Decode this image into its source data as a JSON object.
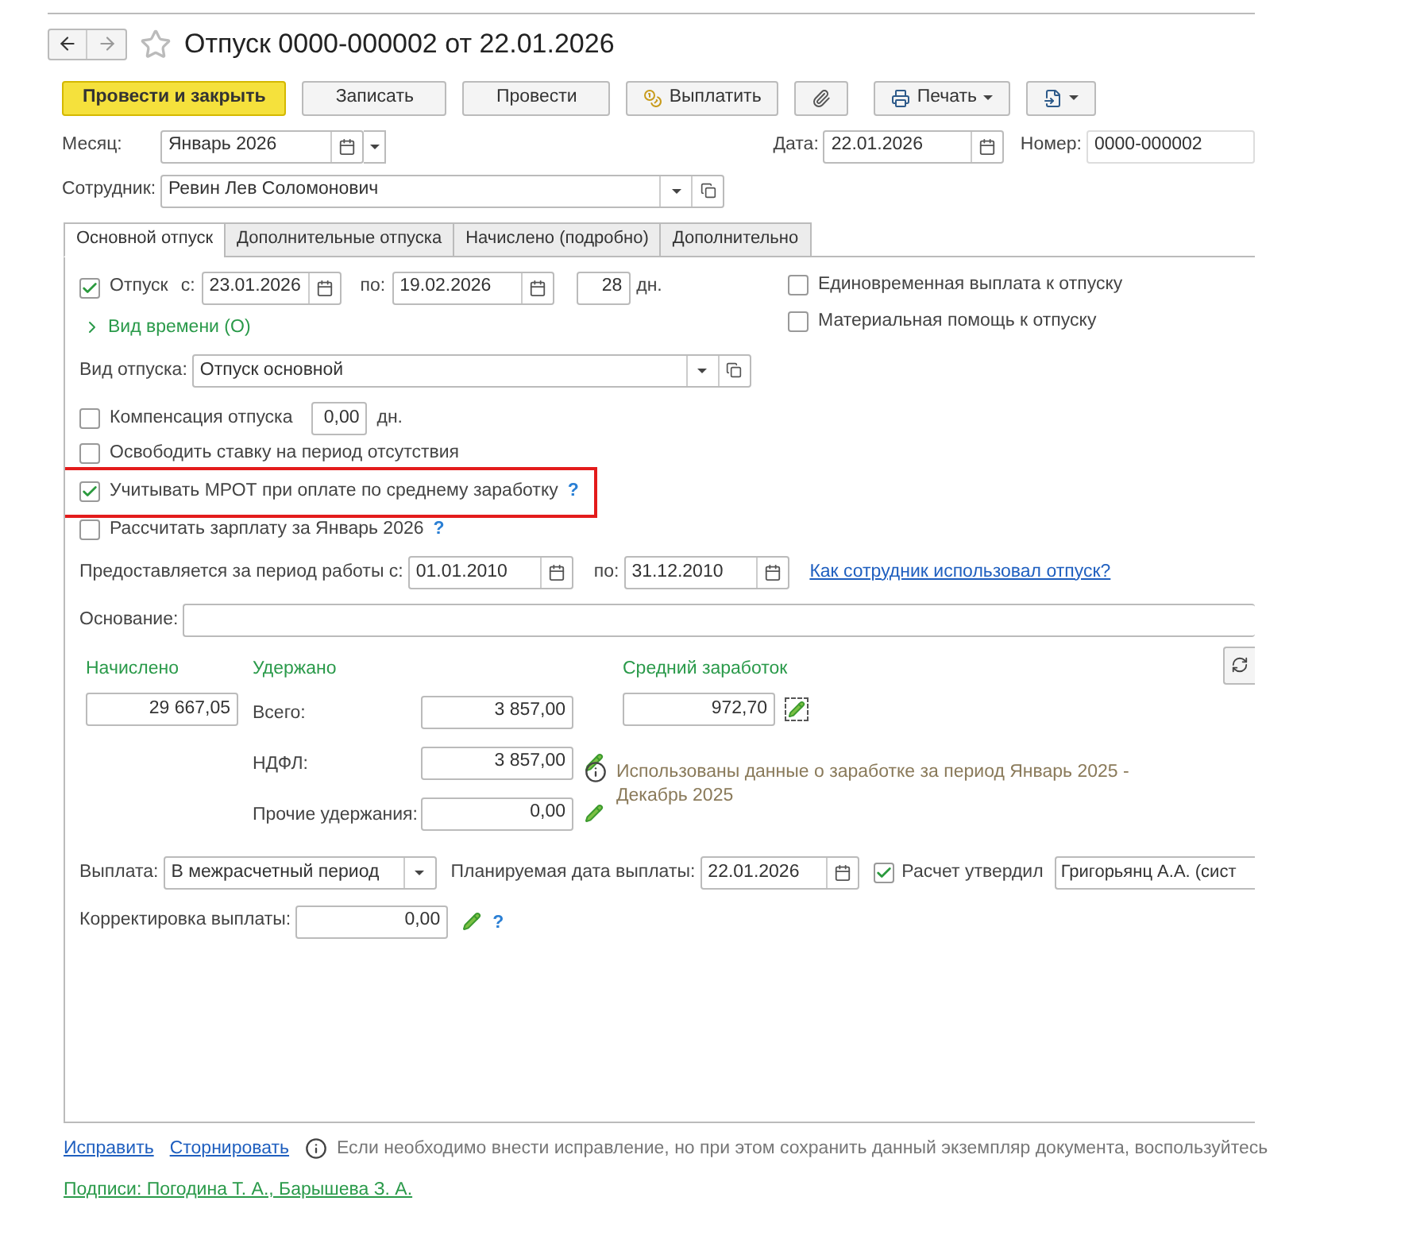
{
  "title": "Отпуск 0000-000002 от 22.01.2026",
  "toolbar": [
    {
      "kind": "primary",
      "label": "Провести и закрыть"
    },
    {
      "kind": "plain",
      "label": "Записать"
    },
    {
      "kind": "plain",
      "label": "Провести"
    },
    {
      "kind": "pay",
      "label": "Выплатить"
    },
    {
      "kind": "clip"
    },
    {
      "kind": "print",
      "label": "Печать"
    },
    {
      "kind": "export"
    }
  ],
  "month": {
    "label": "Месяц:",
    "value": "Январь 2026"
  },
  "date": {
    "label": "Дата:",
    "value": "22.01.2026"
  },
  "number": {
    "label": "Номер:",
    "value": "0000-000002"
  },
  "employee": {
    "label": "Сотрудник:",
    "value": "Ревин Лев Соломонович"
  },
  "tabs": [
    {
      "label": "Основной отпуск",
      "selected": true
    },
    {
      "label": "Дополнительные отпуска",
      "selected": false
    },
    {
      "label": "Начислено (подробно)",
      "selected": false
    },
    {
      "label": "Дополнительно",
      "selected": false
    }
  ],
  "vacation": {
    "label": "Отпуск",
    "checked": true,
    "from_label": "с:",
    "from": "23.01.2026",
    "to_label": "по:",
    "to": "19.02.2026",
    "days": "28",
    "days_unit": "дн."
  },
  "side_options": [
    {
      "label": "Единовременная выплата к отпуску",
      "checked": false
    },
    {
      "label": "Материальная помощь к отпуску",
      "checked": false
    }
  ],
  "time_kind": {
    "label": "Вид времени (О)",
    "expanded": false
  },
  "vacation_type": {
    "label": "Вид отпуска:",
    "value": "Отпуск основной"
  },
  "options": [
    {
      "kind": "amount",
      "label": "Компенсация отпуска",
      "checked": false,
      "value": "0,00",
      "unit": "дн."
    },
    {
      "kind": "plain",
      "label": "Освободить ставку на период отсутствия",
      "checked": false
    },
    {
      "kind": "help",
      "label": "Учитывать МРОТ при оплате по среднему заработку",
      "checked": true,
      "help": "?",
      "highlighted": true
    },
    {
      "kind": "help",
      "label": "Рассчитать зарплату за Январь 2026",
      "checked": false,
      "help": "?",
      "highlighted": false
    }
  ],
  "period": {
    "label": "Предоставляется за период работы с:",
    "from": "01.01.2010",
    "to_label": "по:",
    "to": "31.12.2010",
    "link": "Как сотрудник использовал отпуск?"
  },
  "basis": {
    "label": "Основание:"
  },
  "accrued": {
    "title": "Начислено",
    "value": "29 667,05"
  },
  "withheld": {
    "title": "Удержано",
    "rows": [
      {
        "label": "Всего:",
        "value": "3 857,00",
        "editable": false
      },
      {
        "label": "НДФЛ:",
        "value": "3 857,00",
        "editable": true
      },
      {
        "label": "Прочие удержания:",
        "value": "0,00",
        "editable": true
      }
    ]
  },
  "average": {
    "title": "Средний заработок",
    "value": "972,70"
  },
  "info": "Использованы данные о заработке за период Январь 2025 - Декабрь 2025",
  "payment": {
    "label": "Выплата:",
    "value": "В межрасчетный период",
    "planned_label": "Планируемая дата выплаты:",
    "planned_value": "22.01.2026",
    "approved_label": "Расчет утвердил",
    "approved": true,
    "approver": "Григорьянц А.А. (сист"
  },
  "correction": {
    "label": "Корректировка выплаты:",
    "value": "0,00",
    "help": "?"
  },
  "footer_links": [
    "Исправить",
    "Сторнировать"
  ],
  "footer_info": "Если необходимо внести исправление, но при этом сохранить данный экземпляр документа, воспользуйтесь",
  "signatures": "Подписи: Погодина Т. А., Барышева З. А."
}
